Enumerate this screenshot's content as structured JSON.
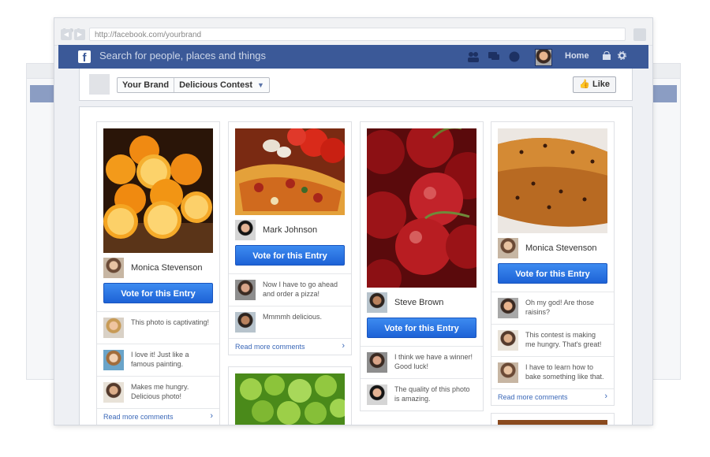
{
  "browser": {
    "url": "http://facebook.com/yourbrand"
  },
  "fb": {
    "logo": "f",
    "search_placeholder": "Search for people, places and things",
    "home_label": "Home",
    "icons": [
      "friends-icon",
      "messages-icon",
      "globe-icon",
      "lock-icon",
      "gear-icon"
    ]
  },
  "page": {
    "brand": "Your Brand",
    "app": "Delicious Contest",
    "like_label": "Like"
  },
  "vote_label": "Vote for this Entry",
  "more_label": "Read more comments",
  "entries": [
    {
      "author": "Monica Stevenson",
      "image": "oranges",
      "comments": [
        "This photo is captivating!",
        "I love it! Just like a famous painting.",
        "Makes me hungry. Delicious photo!"
      ]
    },
    {
      "author": "Mark Johnson",
      "image": "pizza",
      "comments": [
        "Now I have to go ahead and order a pizza!",
        "Mmmmh delicious."
      ]
    },
    {
      "author": "Steve Brown",
      "image": "cherries",
      "comments": [
        "I think we have a winner! Good luck!",
        "The quality of this photo is amazing."
      ]
    },
    {
      "author": "Monica Stevenson",
      "image": "bread",
      "comments": [
        "Oh my god! Are those raisins?",
        "This contest is making me hungry. That's great!",
        "I have to learn how to bake something like that."
      ]
    }
  ]
}
